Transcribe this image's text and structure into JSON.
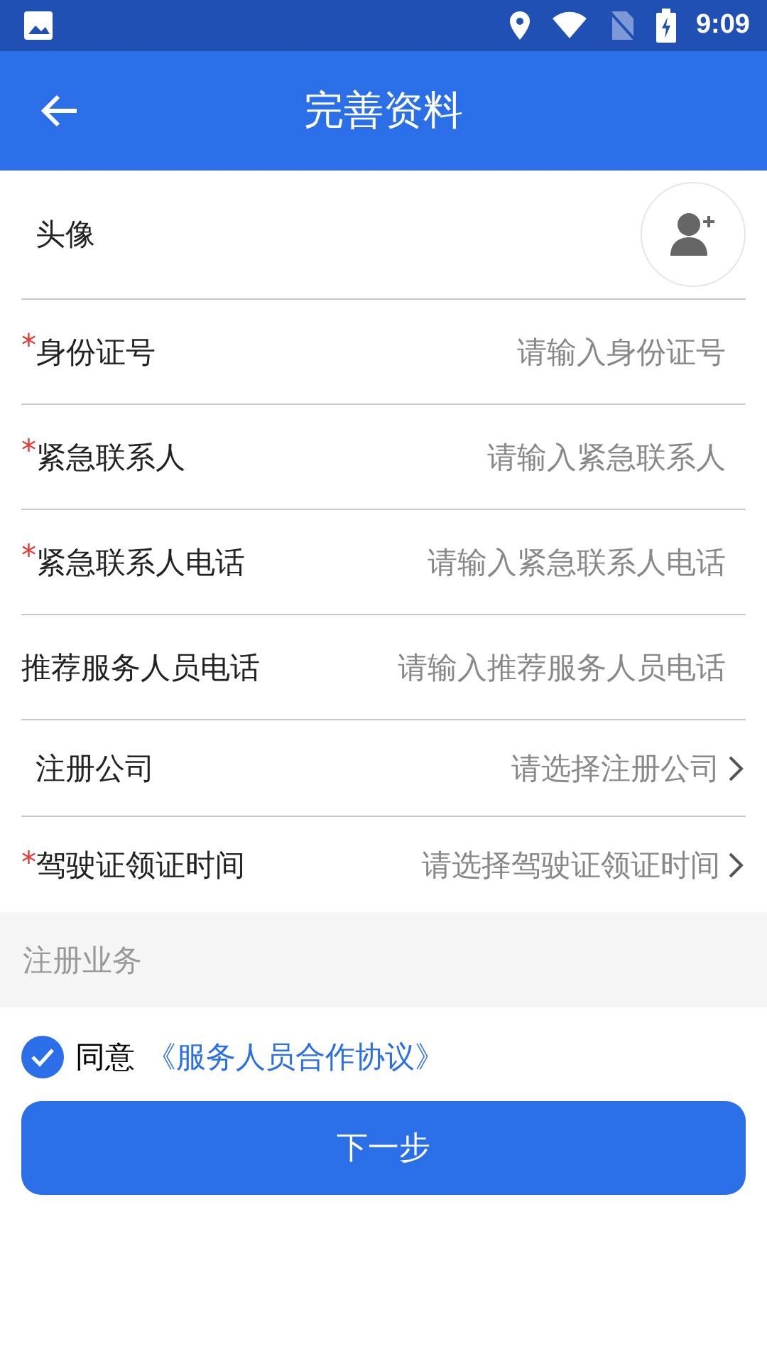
{
  "status_bar": {
    "time": "9:09"
  },
  "header": {
    "title": "完善资料"
  },
  "rows": [
    {
      "kind": "avatar",
      "label": "头像"
    },
    {
      "kind": "input",
      "mark": "*",
      "label": "身份证号",
      "placeholder": "请输入身份证号"
    },
    {
      "kind": "input",
      "mark": "*",
      "label": "紧急联系人",
      "placeholder": "请输入紧急联系人"
    },
    {
      "kind": "input",
      "mark": "*",
      "label": "紧急联系人电话",
      "placeholder": "请输入紧急联系人电话"
    },
    {
      "kind": "input",
      "label": "推荐服务人员电话",
      "placeholder": "请输入推荐服务人员电话"
    },
    {
      "kind": "select",
      "label": "注册公司",
      "placeholder": "请选择注册公司"
    },
    {
      "kind": "select",
      "mark": "*",
      "label": "驾驶证领证时间",
      "placeholder": "请选择驾驶证领证时间"
    }
  ],
  "section": {
    "title": "注册业务"
  },
  "agreement": {
    "checked": true,
    "text": "同意",
    "link": "《服务人员合作协议》"
  },
  "next_button": {
    "label": "下一步"
  }
}
